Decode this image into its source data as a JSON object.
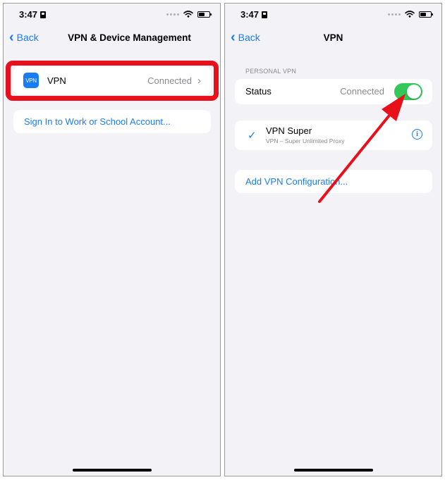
{
  "left": {
    "status": {
      "time": "3:47"
    },
    "nav": {
      "back": "Back",
      "title": "VPN & Device Management"
    },
    "vpn_row": {
      "icon_text": "VPN",
      "label": "VPN",
      "detail": "Connected"
    },
    "sign_in": "Sign In to Work or School Account..."
  },
  "right": {
    "status": {
      "time": "3:47"
    },
    "nav": {
      "back": "Back",
      "title": "VPN"
    },
    "section_header": "PERSONAL VPN",
    "status_row": {
      "label": "Status",
      "detail": "Connected",
      "toggle_on": true
    },
    "vpn_config": {
      "check": "✓",
      "name": "VPN Super",
      "subtitle": "VPN – Super Unlimited Proxy"
    },
    "add_config": "Add VPN Configuration..."
  },
  "colors": {
    "accent": "#1a7cf5",
    "toggle_on": "#34c759",
    "highlight": "#e8111b",
    "background": "#f2f2f7"
  }
}
